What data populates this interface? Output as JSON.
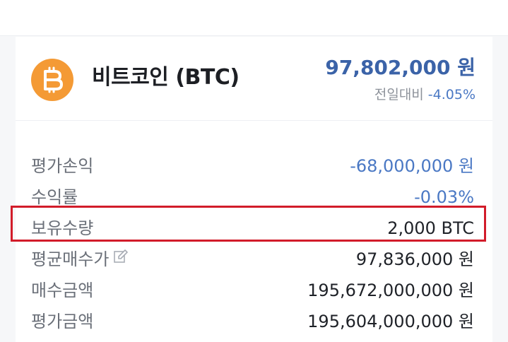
{
  "coin": {
    "name": "비트코인 (BTC)",
    "price": "97,802,000 원",
    "change_label": "전일대비",
    "change_value": "-4.05%",
    "logo_icon": "bitcoin-icon",
    "logo_color": "#f49a35"
  },
  "details": {
    "rows": [
      {
        "label": "평가손익",
        "value": "-68,000,000 원"
      },
      {
        "label": "수익률",
        "value": "-0.03%"
      },
      {
        "label": "보유수량",
        "value": "2,000 BTC"
      },
      {
        "label": "평균매수가",
        "value": "97,836,000 원"
      },
      {
        "label": "매수금액",
        "value": "195,672,000,000 원"
      },
      {
        "label": "평가금액",
        "value": "195,604,000,000 원"
      }
    ]
  },
  "colors": {
    "price_blue": "#3b63a8",
    "negative_blue": "#4a78c4",
    "highlight_red": "#d21c2a"
  }
}
